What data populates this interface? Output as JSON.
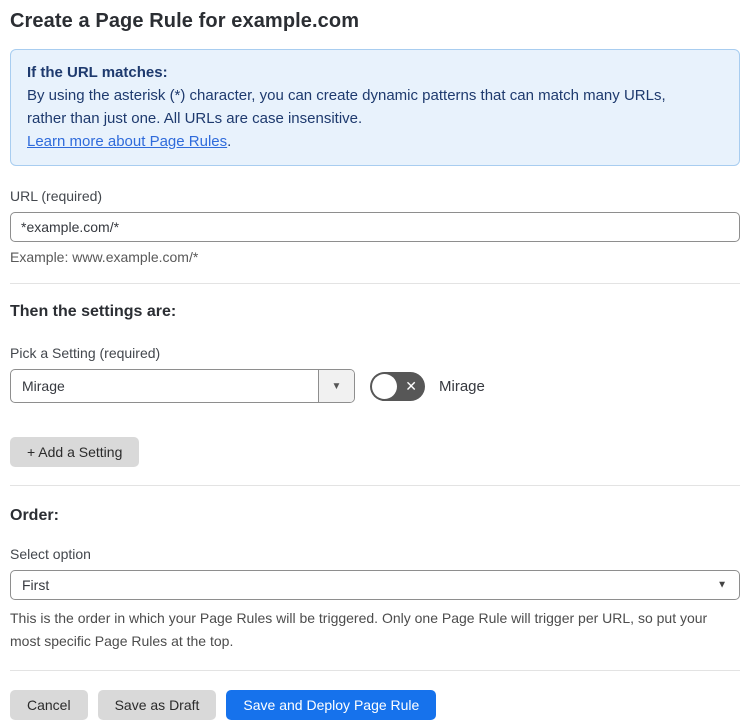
{
  "page": {
    "title": "Create a Page Rule for example.com"
  },
  "info_box": {
    "heading": "If the URL matches:",
    "body_line1": "By using the asterisk (*) character, you can create dynamic patterns that can match many URLs,",
    "body_line2": "rather than just one. All URLs are case insensitive.",
    "link_label": "Learn more about Page Rules",
    "link_suffix": "."
  },
  "url_field": {
    "label": "URL (required)",
    "value": "*example.com/*",
    "helper": "Example: www.example.com/*"
  },
  "settings_section": {
    "heading": "Then the settings are:",
    "picker_label": "Pick a Setting (required)",
    "selected_setting": "Mirage",
    "toggle": {
      "label": "Mirage",
      "state": "off"
    },
    "add_button_label": "+ Add a Setting"
  },
  "order_section": {
    "heading": "Order:",
    "select_label": "Select option",
    "selected_option": "First",
    "helper": "This is the order in which your Page Rules will be triggered. Only one Page Rule will trigger per URL, so put your most specific Page Rules at the top."
  },
  "footer": {
    "cancel_label": "Cancel",
    "save_draft_label": "Save as Draft",
    "save_deploy_label": "Save and Deploy Page Rule"
  },
  "icons": {
    "caret_down": "▼",
    "toggle_x": "✕"
  },
  "colors": {
    "accent_blue": "#1672ec",
    "info_background": "#e8f2fc",
    "info_border": "#a8cdf0",
    "info_text": "#1e3a6e",
    "link_blue": "#2f6bdb",
    "toggle_off_gray": "#575757",
    "button_gray": "#d9d9d9",
    "input_border_gray": "#8e8e8e",
    "divider_gray": "#e3e3e3"
  }
}
